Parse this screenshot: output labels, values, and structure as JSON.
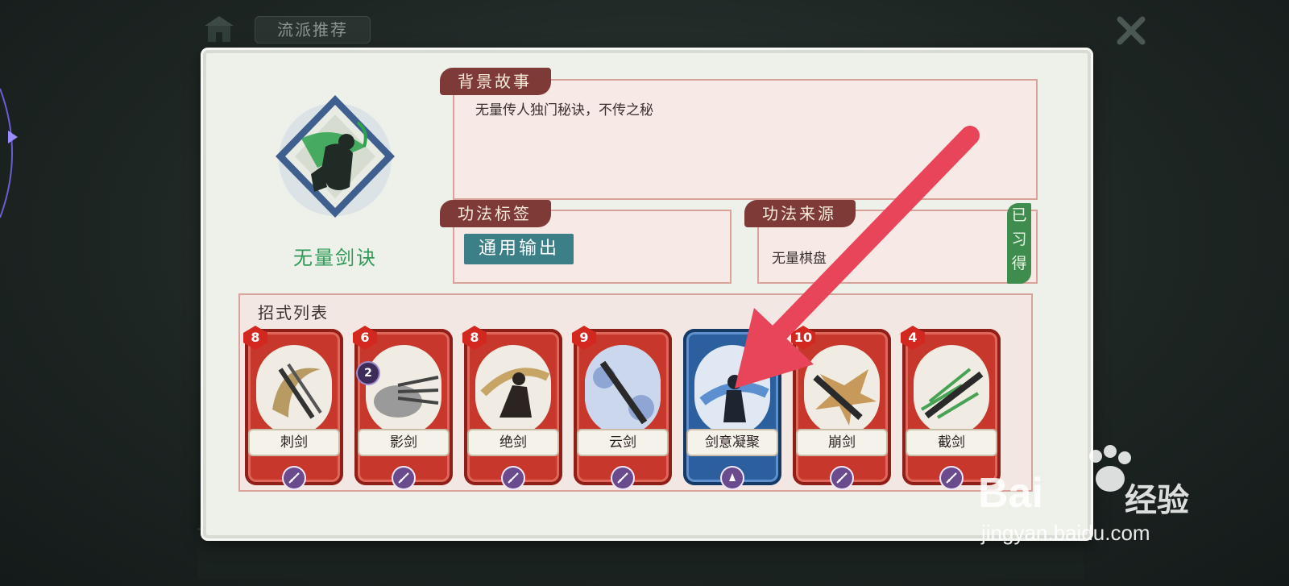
{
  "header": {
    "title_tab": "流派推荐"
  },
  "skill": {
    "name": "无量剑诀"
  },
  "story": {
    "label": "背景故事",
    "text": "无量传人独门秘诀，不传之秘"
  },
  "tags": {
    "label": "功法标签",
    "items": [
      "通用输出"
    ]
  },
  "source": {
    "label": "功法来源",
    "text": "无量棋盘",
    "status_badge": "已习得"
  },
  "moves": {
    "title": "招式列表",
    "cards": [
      {
        "name": "刺剑",
        "cost": "8",
        "color": "red"
      },
      {
        "name": "影剑",
        "cost": "6",
        "charges": "2",
        "color": "red"
      },
      {
        "name": "绝剑",
        "cost": "8",
        "color": "red"
      },
      {
        "name": "云剑",
        "cost": "9",
        "color": "red"
      },
      {
        "name": "剑意凝聚",
        "cost": "",
        "color": "blue"
      },
      {
        "name": "崩剑",
        "cost": "10",
        "color": "red"
      },
      {
        "name": "截剑",
        "cost": "4",
        "color": "red"
      }
    ]
  },
  "colors": {
    "accent_green": "#2f9a56",
    "ribbon": "#7d3a36",
    "card_red": "#c7372c",
    "card_blue": "#2b5f9e",
    "tag_teal": "#3d7f86",
    "annotation_arrow": "#e8455a"
  },
  "watermark": {
    "brand": "Bai",
    "brand_suffix": "经验",
    "url": "jingyan.baidu.com"
  }
}
